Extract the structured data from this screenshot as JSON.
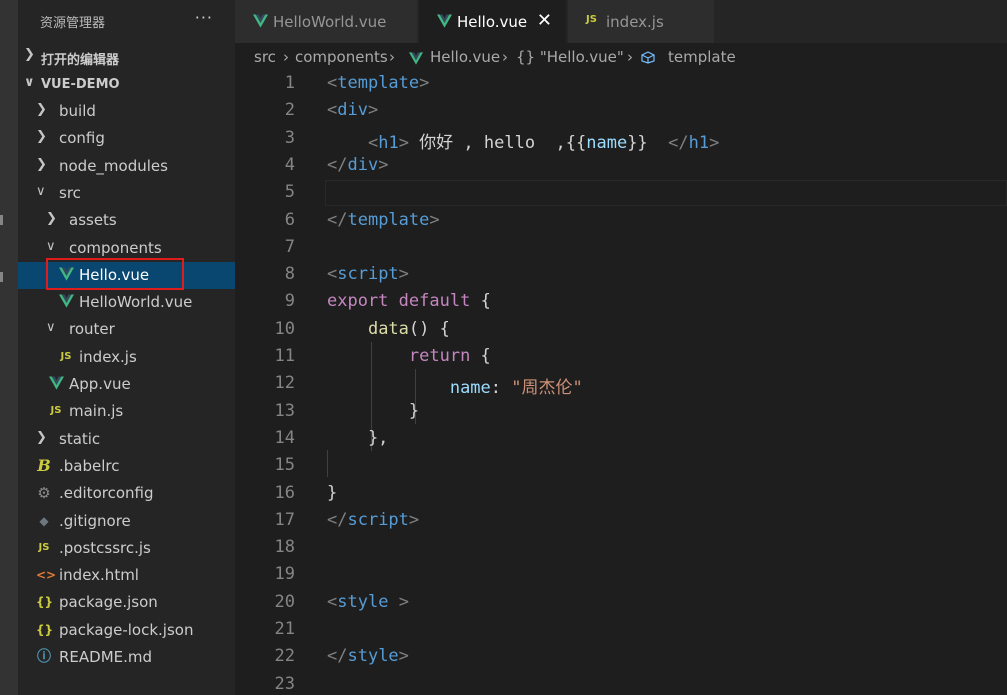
{
  "sidebar": {
    "title": "资源管理器",
    "more": "···",
    "open_editors": "打开的编辑器",
    "project": "VUE-DEMO",
    "items": [
      {
        "label": "build"
      },
      {
        "label": "config"
      },
      {
        "label": "node_modules"
      },
      {
        "label": "src"
      },
      {
        "label": "assets"
      },
      {
        "label": "components"
      },
      {
        "label": "Hello.vue"
      },
      {
        "label": "HelloWorld.vue"
      },
      {
        "label": "router"
      },
      {
        "label": "index.js"
      },
      {
        "label": "App.vue"
      },
      {
        "label": "main.js"
      },
      {
        "label": "static"
      },
      {
        "label": ".babelrc"
      },
      {
        "label": ".editorconfig"
      },
      {
        "label": ".gitignore"
      },
      {
        "label": ".postcssrc.js"
      },
      {
        "label": "index.html"
      },
      {
        "label": "package.json"
      },
      {
        "label": "package-lock.json"
      },
      {
        "label": "README.md"
      }
    ]
  },
  "tabs": [
    {
      "label": "HelloWorld.vue",
      "icon": "vue-icon",
      "active": false
    },
    {
      "label": "Hello.vue",
      "icon": "vue-icon",
      "active": true,
      "close": "✕"
    },
    {
      "label": "index.js",
      "icon": "js-icon",
      "active": false
    }
  ],
  "icons": {
    "js": "JS",
    "json": "{}",
    "html": "<>",
    "babel": "B",
    "gear": "⚙",
    "git": "◆",
    "info": "ⓘ"
  },
  "breadcrumb": [
    "src",
    "components",
    "Hello.vue",
    "{} \"Hello.vue\"",
    "template"
  ],
  "line_numbers": [
    "1",
    "2",
    "3",
    "4",
    "5",
    "6",
    "7",
    "8",
    "9",
    "10",
    "11",
    "12",
    "13",
    "14",
    "15",
    "16",
    "17",
    "18",
    "19",
    "20",
    "21",
    "22",
    "23"
  ],
  "code": [
    [
      [
        "t-punc",
        "<"
      ],
      [
        "t-tag",
        "template"
      ],
      [
        "t-punc",
        ">"
      ]
    ],
    [
      [
        "t-punc",
        "<"
      ],
      [
        "t-tag",
        "div"
      ],
      [
        "t-punc",
        ">"
      ]
    ],
    [
      [
        "t-text",
        "    "
      ],
      [
        "t-punc",
        "<"
      ],
      [
        "t-tag",
        "h1"
      ],
      [
        "t-punc",
        ">"
      ],
      [
        "t-text",
        " 你好 , hello  ,{{"
      ],
      [
        "t-prop",
        "name"
      ],
      [
        "t-text",
        "}}  "
      ],
      [
        "t-punc",
        "</"
      ],
      [
        "t-tag",
        "h1"
      ],
      [
        "t-punc",
        ">"
      ]
    ],
    [
      [
        "t-punc",
        "</"
      ],
      [
        "t-tag",
        "div"
      ],
      [
        "t-punc",
        ">"
      ]
    ],
    [],
    [
      [
        "t-punc",
        "</"
      ],
      [
        "t-tag",
        "template"
      ],
      [
        "t-punc",
        ">"
      ]
    ],
    [],
    [
      [
        "t-punc",
        "<"
      ],
      [
        "t-tag",
        "script"
      ],
      [
        "t-punc",
        ">"
      ]
    ],
    [
      [
        "t-kw",
        "export"
      ],
      [
        "t-text",
        " "
      ],
      [
        "t-kw",
        "default"
      ],
      [
        "t-text",
        " {"
      ]
    ],
    [
      [
        "t-text",
        "    "
      ],
      [
        "t-fn",
        "data"
      ],
      [
        "t-text",
        "() {"
      ]
    ],
    [
      [
        "t-text",
        "        "
      ],
      [
        "t-kw",
        "return"
      ],
      [
        "t-text",
        " {"
      ]
    ],
    [
      [
        "t-text",
        "            "
      ],
      [
        "t-prop",
        "name"
      ],
      [
        "t-text",
        ": "
      ],
      [
        "t-str",
        "\"周杰伦\""
      ]
    ],
    [
      [
        "t-text",
        "        }"
      ]
    ],
    [
      [
        "t-text",
        "    },"
      ]
    ],
    [],
    [
      [
        "t-text",
        "}"
      ]
    ],
    [
      [
        "t-punc",
        "</"
      ],
      [
        "t-tag",
        "script"
      ],
      [
        "t-punc",
        ">"
      ]
    ],
    [],
    [],
    [
      [
        "t-punc",
        "<"
      ],
      [
        "t-tag",
        "style"
      ],
      [
        "t-text",
        " "
      ],
      [
        "t-punc",
        ">"
      ]
    ],
    [],
    [
      [
        "t-punc",
        "</"
      ],
      [
        "t-tag",
        "style"
      ],
      [
        "t-punc",
        ">"
      ]
    ],
    []
  ]
}
